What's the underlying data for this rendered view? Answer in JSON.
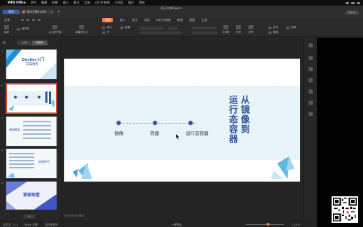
{
  "menubar": {
    "app": "WPS Office",
    "items": [
      "文件",
      "编辑",
      "视图",
      "插入",
      "格式",
      "工具",
      "幻灯片放映",
      "工作区",
      "窗口",
      "帮助"
    ]
  },
  "window": {
    "title": "演示文稿1.pptx",
    "home_tab": "首页",
    "doc_tab": "演示文稿1.pptx",
    "user": "Friend"
  },
  "ribbon": {
    "file_label": "文件",
    "tabs": [
      "开始",
      "插入",
      "设计",
      "动画",
      "幻灯片放映",
      "审阅",
      "视图",
      "工具"
    ],
    "active_tab": "开始"
  },
  "toolbar": {
    "paste": "粘贴",
    "format_painter": "格式刷",
    "from_start": "从当前开始",
    "new_slide": "新建幻灯片",
    "layout": "版式",
    "section": "节",
    "reset": "重置",
    "text_box": "文本框",
    "shape": "形状",
    "arrange": "排列",
    "find": "查找",
    "replace": "替换",
    "select": "选择"
  },
  "left_pane": {
    "tabs": [
      "大纲",
      "幻灯片"
    ],
    "active_tab": "幻灯片",
    "add_label": "+",
    "thumbs": [
      {
        "num": "1",
        "title": "Docker入门",
        "subtitle": "实操教程"
      },
      {
        "num": "2",
        "title": ""
      },
      {
        "num": "3",
        "title": "基础概念"
      },
      {
        "num": "4",
        "title": "实操环节"
      },
      {
        "num": "5",
        "title": "谢谢观看"
      }
    ]
  },
  "slide": {
    "stages": [
      "镜像",
      "容器",
      "运行态容器"
    ],
    "title_line1": "从镜像到",
    "title_line2": "运行态容器"
  },
  "notes": {
    "placeholder": "单击此处添加备注"
  },
  "statusbar": {
    "page": "幻灯片 2 / 5",
    "theme": "Office 主题",
    "doc_protect": "文档未保护",
    "beautify": "一键美化",
    "zoom": "113 %"
  },
  "colors": {
    "accent": "#ff7a3c",
    "slide_blue": "#2f5597",
    "selected_border": "#d04a33"
  }
}
